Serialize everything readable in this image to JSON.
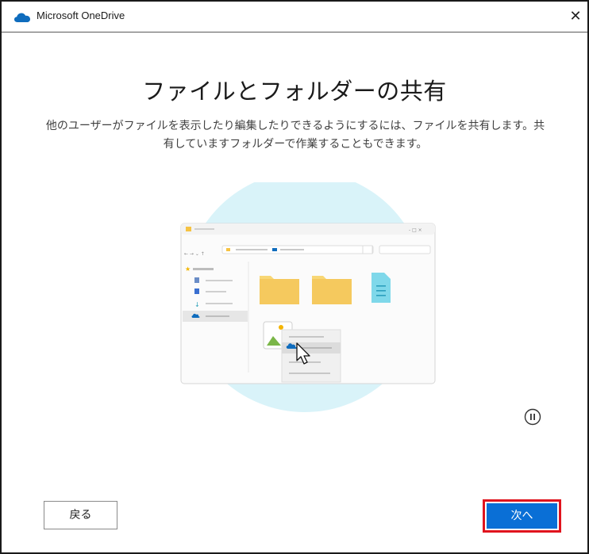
{
  "window": {
    "title": "Microsoft OneDrive",
    "close_glyph": "✕"
  },
  "content": {
    "heading": "ファイルとフォルダーの共有",
    "description": "他のユーザーがファイルを表示したり編集したりできるようにするには、ファイルを共有します。共有していますフォルダーで作業することもできます。"
  },
  "buttons": {
    "back": "戻る",
    "next": "次へ"
  },
  "icons": {
    "app": "onedrive-cloud-icon",
    "pause": "pause-icon",
    "close": "close-icon"
  },
  "colors": {
    "accent": "#0a6fd6",
    "highlight": "#e0141e",
    "cloud": "#0f6cbd",
    "folder": "#f8d775",
    "illustration_circle": "#d9f3f9"
  }
}
